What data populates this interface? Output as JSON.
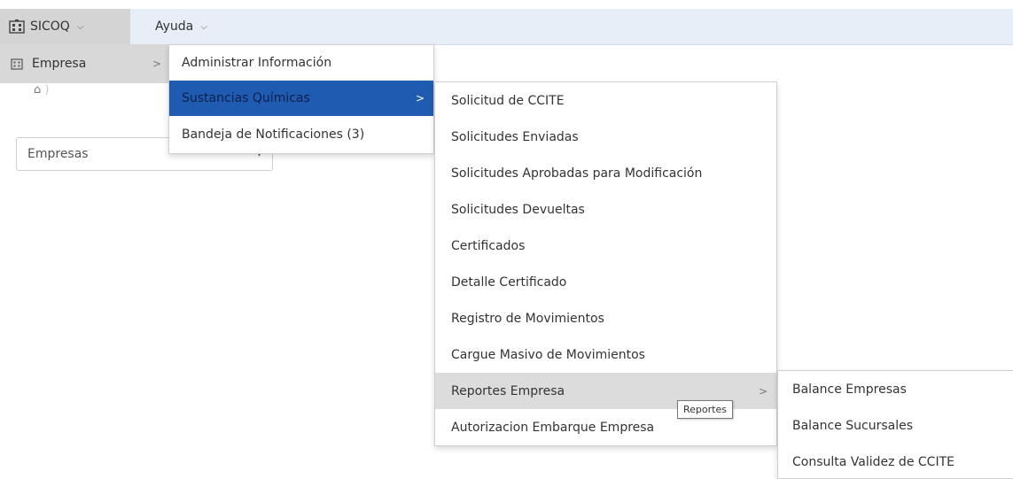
{
  "menubar": {
    "app_label": "SICOQ",
    "help_label": "Ayuda"
  },
  "page": {
    "home_symbol": "⌂",
    "empresas_select_value": "Empresas"
  },
  "menu_level1": {
    "items": [
      {
        "label": "Empresa",
        "has_submenu": true
      }
    ]
  },
  "menu_level2": {
    "items": [
      {
        "label": "Administrar Información"
      },
      {
        "label": "Sustancias Químicas",
        "has_submenu": true
      },
      {
        "label": "Bandeja de Notificaciones (3)"
      }
    ]
  },
  "menu_level3": {
    "items": [
      {
        "label": "Solicitud de CCITE"
      },
      {
        "label": "Solicitudes Enviadas"
      },
      {
        "label": "Solicitudes Aprobadas para Modificación"
      },
      {
        "label": "Solicitudes Devueltas"
      },
      {
        "label": "Certificados"
      },
      {
        "label": "Detalle Certificado"
      },
      {
        "label": "Registro de Movimientos"
      },
      {
        "label": "Cargue Masivo de Movimientos"
      },
      {
        "label": "Reportes Empresa",
        "has_submenu": true
      },
      {
        "label": "Autorizacion Embarque Empresa"
      }
    ]
  },
  "menu_level4": {
    "items": [
      {
        "label": "Balance Empresas"
      },
      {
        "label": "Balance Sucursales"
      },
      {
        "label": "Consulta Validez de CCITE"
      }
    ]
  },
  "tooltip": {
    "text": "Reportes"
  },
  "colors": {
    "menubar_bg": "#e7eef8",
    "selected_bg": "#1f5cb1",
    "hover_bg": "#dcdcdc"
  }
}
